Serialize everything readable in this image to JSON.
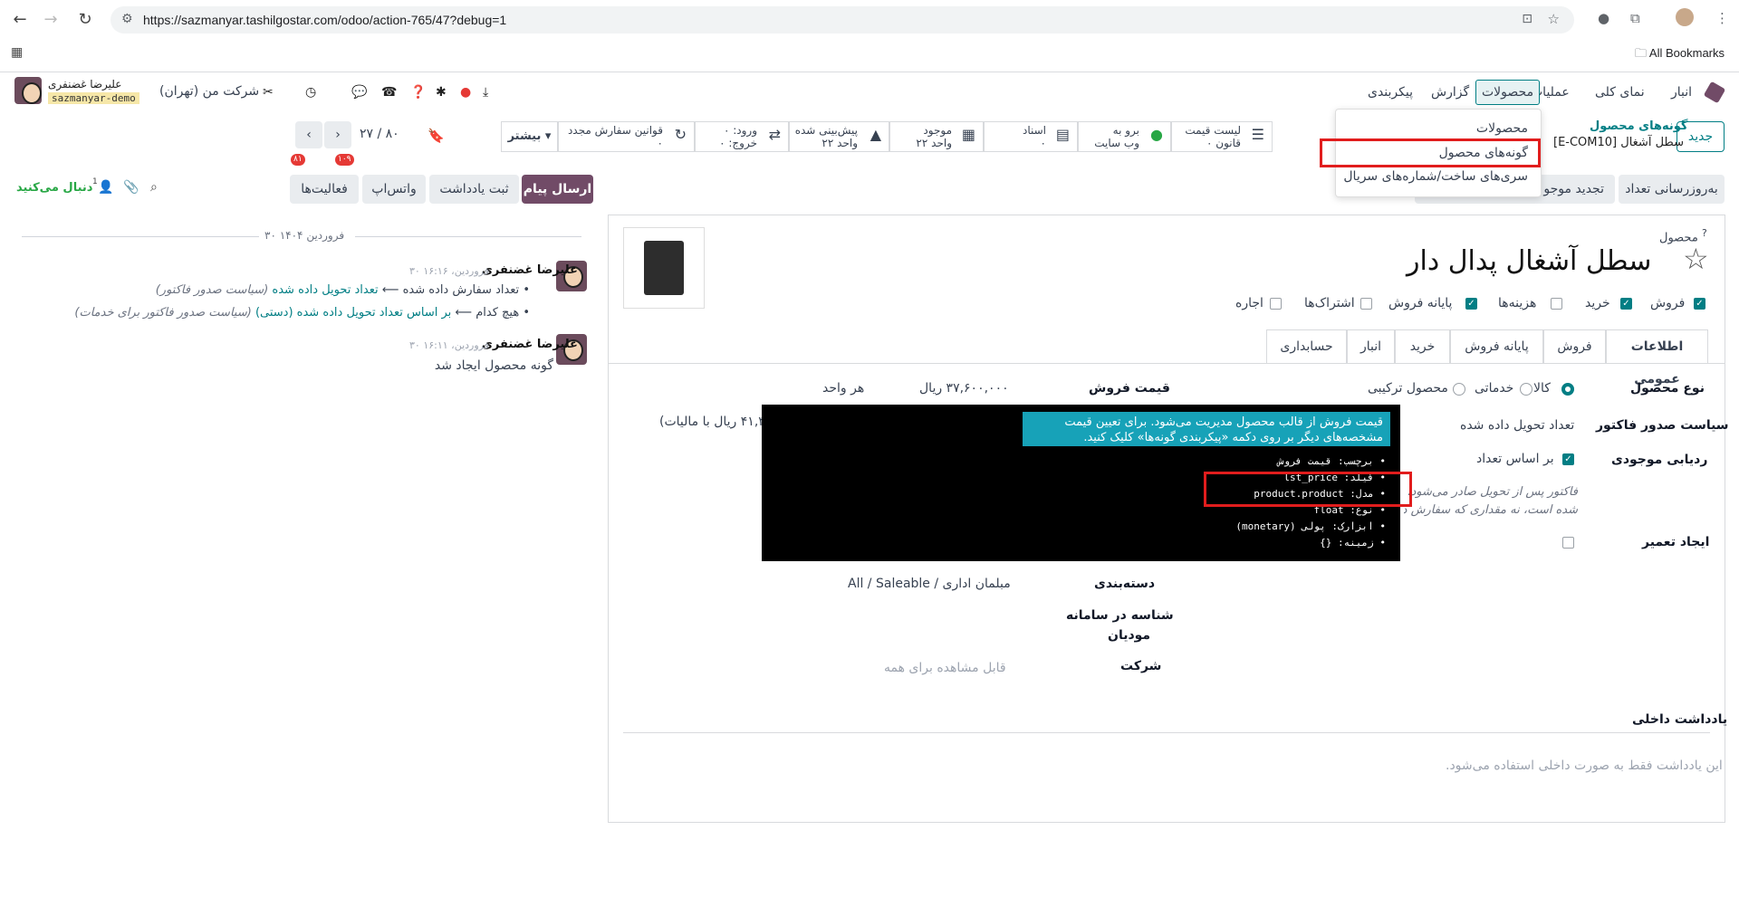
{
  "browser": {
    "url": "https://sazmanyar.tashilgostar.com/odoo/action-765/47?debug=1",
    "all_bookmarks": "All Bookmarks"
  },
  "topnav": {
    "app_name": "انبار",
    "menu": [
      "نمای کلی",
      "عملیات",
      "محصولات",
      "گزارش",
      "پیکربندی"
    ],
    "company": "شرکت من (تهران)",
    "user_name": "علیرضا غضنفری",
    "db_name": "sazmanyar-demo",
    "badge_messages": "۱۰۹",
    "badge_activities": "۸۱"
  },
  "dropdown": {
    "items": [
      "محصولات",
      "گونه‌های محصول",
      "سری‌های ساخت/شماره‌های سریال"
    ]
  },
  "controlpanel": {
    "new_button": "جدید",
    "breadcrumb_parent": "گونه‌های محصول",
    "breadcrumb_current": "[E-COM10] سطل آشغال",
    "pager": "۲۷ / ۸۰",
    "more_button": "بیشتر",
    "smart_buttons": [
      {
        "line1": "لیست قیمت",
        "line2": "۰ قانون"
      },
      {
        "line1": "برو به",
        "line2": "وب سایت"
      },
      {
        "line1": "اسناد",
        "line2": "۰"
      },
      {
        "line1": "موجود",
        "line2": "۲۲ واحد"
      },
      {
        "line1": "پیش‌بینی شده",
        "line2": "۲۲ واحد"
      },
      {
        "line1": "ورود: ۰",
        "line2": "خروج: ۰"
      },
      {
        "line1": "قوانین سفارش مجدد",
        "line2": "۰"
      }
    ]
  },
  "actions": {
    "update_qty": "به‌روزرسانی تعداد",
    "replenish": "تجدید موجو",
    "send_message": "ارسال پیام",
    "log_note": "ثبت یادداشت",
    "whatsapp": "واتس‌اپ",
    "activities": "فعالیت‌ها",
    "follow": "دنبال می‌کنید",
    "followers_count": "1"
  },
  "form": {
    "label_product": "محصول",
    "product_name": "سطل آشغال پدال دار",
    "checkboxes": [
      {
        "label": "فروش",
        "checked": true
      },
      {
        "label": "خرید",
        "checked": true
      },
      {
        "label": "هزینه‌ها",
        "checked": false
      },
      {
        "label": "پایانه فروش",
        "checked": true
      },
      {
        "label": "اشتراک‌ها",
        "checked": false
      },
      {
        "label": "اجاره",
        "checked": false
      }
    ],
    "tabs": [
      "اطلاعات عمومی",
      "فروش",
      "پایانه فروش",
      "خرید",
      "انبار",
      "حسابداری"
    ],
    "product_type_label": "نوع محصول",
    "product_type_options": [
      "کالا",
      "خدماتی",
      "محصول ترکیبی"
    ],
    "invoice_policy_label": "سیاست صدور فاکتور",
    "invoice_policy_value": "تعداد تحویل داده شده",
    "track_inventory_label": "ردیابی موجودی",
    "track_inventory_value": "بر اساس تعداد",
    "invoice_note": "فاکتور پس از تحویل صادر می‌شود، بر اساس مقداری که تحویل داده",
    "invoice_note2": "شده است، نه مقداری که سفارش د",
    "create_repair_label": "ایجاد تعمیر",
    "sales_price_label": "قیمت فروش",
    "sales_price_value": "۳۷,۶۰۰,۰۰۰ ریال",
    "per_unit": "هر واحد",
    "with_tax": "۴۱,۳ ریال با مالیات)",
    "category_label": "دسته‌بندی",
    "category_value": "All / Saleable / مبلمان اداری",
    "moadian_label_1": "شناسه در سامانه",
    "moadian_label_2": "مودیان",
    "company_label": "شرکت",
    "company_placeholder": "قابل مشاهده برای همه",
    "internal_note_label": "یادداشت داخلی",
    "internal_note_placeholder": "این یادداشت فقط به صورت داخلی استفاده می‌شود."
  },
  "tooltip": {
    "help_line1": "قیمت فروش از قالب محصول مدیریت می‌شود. برای تعیین قیمت",
    "help_line2": "مشخصه‌های دیگر بر روی دکمه «پیکربندی گونه‌ها» کلیک کنید.",
    "lines": [
      "• برچسب: قیمت فروش",
      "• فیلد: lst_price",
      "• مدل: product.product",
      "• نوع: float",
      "• ابزارک: پولی (monetary)",
      "• زمینه: {}"
    ]
  },
  "chatter": {
    "date_separator": "۳۰ فروردین ۱۴۰۴",
    "messages": [
      {
        "author": "علیرضا غضنفری",
        "time": "۳۰ فروردین، ۱۶:۱۶",
        "line1_prefix": "تعداد سفارش داده شده",
        "line1_arrow": "⟵",
        "line1_link": "تعداد تحویل داده شده",
        "line1_suffix": "(سیاست صدور فاکتور)",
        "line2_prefix": "هیچ کدام",
        "line2_arrow": "⟵",
        "line2_link": "بر اساس تعداد تحویل داده شده (دستی)",
        "line2_suffix": "(سیاست صدور فاکتور برای خدمات)"
      },
      {
        "author": "علیرضا غضنفری",
        "time": "۳۰ فروردین، ۱۶:۱۱",
        "body": "گونه محصول ایجاد شد"
      }
    ]
  },
  "colors": {
    "primary": "#714b67",
    "teal": "#017e84",
    "highlight": "#e11d1d",
    "help_bg": "#17a2b8"
  }
}
